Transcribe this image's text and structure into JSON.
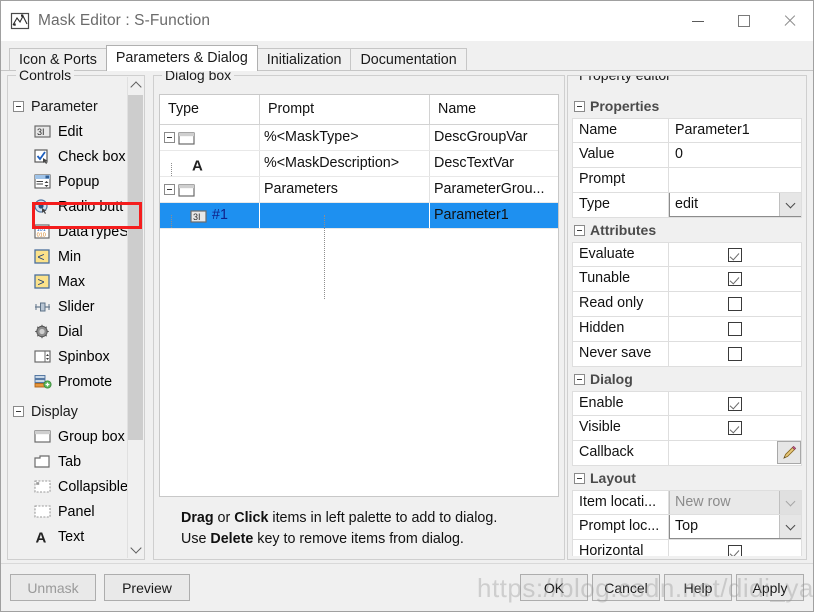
{
  "window": {
    "title": "Mask Editor : S-Function",
    "icon": "mask-editor-icon",
    "minimize_label": "Minimize",
    "maximize_label": "Maximize",
    "close_label": "Close"
  },
  "tabs": [
    {
      "label": "Icon & Ports",
      "active": false
    },
    {
      "label": "Parameters & Dialog",
      "active": true
    },
    {
      "label": "Initialization",
      "active": false
    },
    {
      "label": "Documentation",
      "active": false
    }
  ],
  "palette": {
    "legend": "Controls",
    "groups": [
      {
        "label": "Parameter",
        "items": [
          {
            "label": "Edit",
            "icon": "edit-field-icon",
            "highlighted": true
          },
          {
            "label": "Check box",
            "icon": "check-box-icon"
          },
          {
            "label": "Popup",
            "icon": "popup-icon"
          },
          {
            "label": "Radio butt",
            "icon": "radio-button-icon"
          },
          {
            "label": "DataTypeS",
            "icon": "datatype-selector-icon"
          },
          {
            "label": "Min",
            "icon": "min-icon"
          },
          {
            "label": "Max",
            "icon": "max-icon"
          },
          {
            "label": "Slider",
            "icon": "slider-icon"
          },
          {
            "label": "Dial",
            "icon": "dial-icon"
          },
          {
            "label": "Spinbox",
            "icon": "spinbox-icon"
          },
          {
            "label": "Promote",
            "icon": "promote-icon"
          }
        ]
      },
      {
        "label": "Display",
        "items": [
          {
            "label": "Group box",
            "icon": "group-box-icon"
          },
          {
            "label": "Tab",
            "icon": "tab-icon"
          },
          {
            "label": "Collapsible",
            "icon": "collapsible-panel-icon"
          },
          {
            "label": "Panel",
            "icon": "panel-icon"
          },
          {
            "label": "Text",
            "icon": "text-icon"
          }
        ]
      }
    ]
  },
  "dialog_box": {
    "legend": "Dialog box",
    "columns": [
      "Type",
      "Prompt",
      "Name"
    ],
    "rows": [
      {
        "indent": 1,
        "icon": "group-box-icon",
        "expander": true,
        "type_label": "",
        "prompt": "%<MaskType>",
        "name": "DescGroupVar",
        "selected": false
      },
      {
        "indent": 2,
        "icon": "text-icon",
        "expander": false,
        "type_label": "",
        "prompt": "%<MaskDescription>",
        "name": "DescTextVar",
        "selected": false
      },
      {
        "indent": 1,
        "icon": "group-box-icon",
        "expander": true,
        "type_label": "",
        "prompt": "Parameters",
        "name": "ParameterGrou...",
        "selected": false
      },
      {
        "indent": 2,
        "icon": "edit-field-icon",
        "expander": false,
        "type_label": "#1",
        "prompt": "",
        "name": "Parameter1",
        "selected": true
      }
    ],
    "hint_line1_parts": [
      "Drag",
      " or ",
      "Click",
      " items in left palette to add to dialog."
    ],
    "hint_line2_parts": [
      "Use ",
      "Delete",
      " key to remove items from dialog."
    ]
  },
  "property_editor": {
    "legend": "Property editor",
    "sections": [
      {
        "title": "Properties",
        "rows": [
          {
            "label": "Name",
            "value": "Parameter1",
            "kind": "text"
          },
          {
            "label": "Value",
            "value": "0",
            "kind": "text"
          },
          {
            "label": "Prompt",
            "value": "",
            "kind": "text"
          },
          {
            "label": "Type",
            "value": "edit",
            "kind": "combo",
            "disabled": false
          }
        ]
      },
      {
        "title": "Attributes",
        "rows": [
          {
            "label": "Evaluate",
            "value": "",
            "kind": "checkbox",
            "checked": true
          },
          {
            "label": "Tunable",
            "value": "",
            "kind": "checkbox",
            "checked": true
          },
          {
            "label": "Read only",
            "value": "",
            "kind": "checkbox",
            "checked": false
          },
          {
            "label": "Hidden",
            "value": "",
            "kind": "checkbox",
            "checked": false
          },
          {
            "label": "Never save",
            "value": "",
            "kind": "checkbox",
            "checked": false
          }
        ]
      },
      {
        "title": "Dialog",
        "rows": [
          {
            "label": "Enable",
            "value": "",
            "kind": "checkbox",
            "checked": true
          },
          {
            "label": "Visible",
            "value": "",
            "kind": "checkbox",
            "checked": true
          },
          {
            "label": "Callback",
            "value": "",
            "kind": "pencil"
          }
        ]
      },
      {
        "title": "Layout",
        "rows": [
          {
            "label": "Item locati...",
            "value": "New row",
            "kind": "combo",
            "disabled": true
          },
          {
            "label": "Prompt loc...",
            "value": "Top",
            "kind": "combo",
            "disabled": false
          },
          {
            "label": "Horizontal",
            "value": "",
            "kind": "checkbox",
            "checked": true
          }
        ]
      }
    ]
  },
  "footer": {
    "left_buttons": [
      {
        "label": "Unmask",
        "disabled": true
      },
      {
        "label": "Preview",
        "disabled": false
      }
    ],
    "right_buttons": [
      {
        "label": "OK",
        "disabled": false
      },
      {
        "label": "Cancel",
        "disabled": false
      },
      {
        "label": "Help",
        "disabled": false
      },
      {
        "label": "Apply",
        "disabled": false
      }
    ]
  },
  "watermark": {
    "text": "https://blog.csdn.net/didi_ya"
  },
  "colors": {
    "selection_blue": "#1e90f0",
    "highlight_red": "#f41d1d",
    "window_bg": "#f0f0f0",
    "panel_white": "#ffffff"
  }
}
